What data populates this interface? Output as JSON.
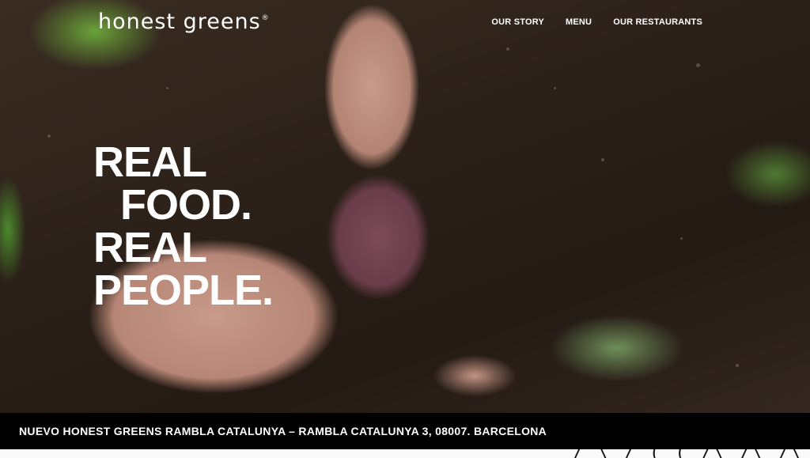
{
  "header": {
    "logo_text": "honest greens",
    "logo_mark": "®",
    "nav": [
      {
        "label": "OUR STORY"
      },
      {
        "label": "MENU"
      },
      {
        "label": "OUR RESTAURANTS"
      }
    ]
  },
  "hero": {
    "headline_lines": [
      "REAL",
      "FOOD.",
      "REAL",
      "PEOPLE."
    ],
    "image": "hands-pulling-beetroot-from-soil-photo"
  },
  "banner": {
    "text": "NUEVO HONEST GREENS RAMBLA CATALUNYA – RAMBLA CATALUNYA 3, 08007. BARCELONA"
  },
  "footer_strip": {
    "doodle_icon": "hand-drawn-doodle-icon"
  },
  "colors": {
    "text": "#ffffff",
    "banner_bg": "#000000",
    "soil": "#2c2119",
    "beet": "#6a3d4a",
    "leaf": "#5a8f2f"
  }
}
